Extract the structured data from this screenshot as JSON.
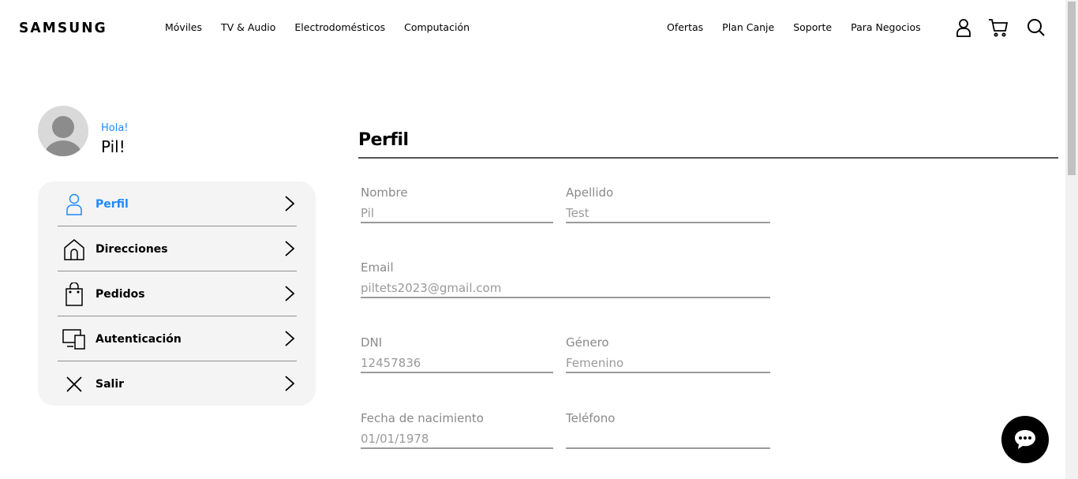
{
  "header": {
    "logo": "SAMSUNG",
    "nav_left": [
      "Móviles",
      "TV & Audio",
      "Electrodomésticos",
      "Computación"
    ],
    "nav_right": [
      "Ofertas",
      "Plan Canje",
      "Soporte",
      "Para Negocios"
    ],
    "icons": [
      "user-icon",
      "cart-icon",
      "search-icon"
    ]
  },
  "greeting": {
    "hello": "Hola!",
    "name": "Pil!"
  },
  "menu": {
    "items": [
      {
        "label": "Perfil",
        "icon": "person-icon",
        "active": true
      },
      {
        "label": "Direcciones",
        "icon": "house-icon"
      },
      {
        "label": "Pedidos",
        "icon": "bag-icon"
      },
      {
        "label": "Autenticación",
        "icon": "devices-icon"
      },
      {
        "label": "Salir",
        "icon": "close-icon"
      }
    ]
  },
  "main": {
    "title": "Perfil",
    "fields": {
      "nombre": {
        "label": "Nombre",
        "value": "Pil"
      },
      "apellido": {
        "label": "Apellido",
        "value": "Test"
      },
      "email": {
        "label": "Email",
        "value": "piltets2023@gmail.com"
      },
      "dni": {
        "label": "DNI",
        "value": "12457836"
      },
      "genero": {
        "label": "Género",
        "value": "Femenino"
      },
      "fecha": {
        "label": "Fecha de nacimiento",
        "value": "01/01/1978"
      },
      "telefono": {
        "label": "Teléfono",
        "value": ""
      }
    }
  },
  "colors": {
    "accent": "#2189ff",
    "menu_bg": "#f4f4f4",
    "text": "#000000",
    "muted": "#8a8a8a"
  },
  "chat": {
    "icon": "chat-bubble-icon"
  }
}
